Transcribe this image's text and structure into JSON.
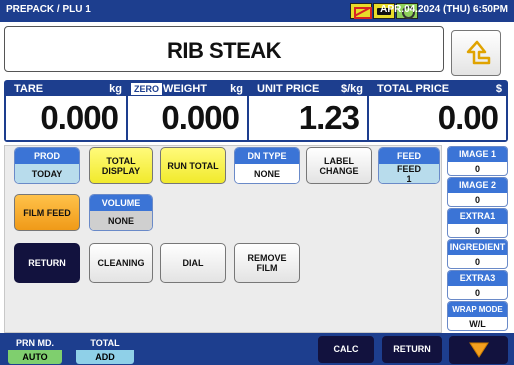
{
  "header": {
    "breadcrumb": "PREPACK / PLU 1",
    "datetime": "APR.04.2024 (THU)  6:50PM",
    "status_icons": [
      "no-label-icon",
      "battery-icon",
      "network-icon"
    ]
  },
  "product": {
    "name": "RIB STEAK"
  },
  "display": {
    "tare": {
      "label": "TARE",
      "unit": "kg",
      "value": "0.000"
    },
    "weight": {
      "badge": "ZERO",
      "label": "WEIGHT",
      "unit": "kg",
      "value": "0.000"
    },
    "unit_price": {
      "label": "UNIT PRICE",
      "unit": "$/kg",
      "value": "1.23"
    },
    "total_price": {
      "label": "TOTAL PRICE",
      "unit": "$",
      "value": "0.00"
    }
  },
  "buttons": {
    "prod": {
      "label": "PROD",
      "value": "TODAY"
    },
    "total_display": "TOTAL\nDISPLAY",
    "run_total": "RUN TOTAL",
    "dn_type": {
      "label": "DN TYPE",
      "value": "NONE"
    },
    "label_change": "LABEL\nCHANGE",
    "feed": {
      "label": "FEED",
      "value": "FEED\n1"
    },
    "film_feed": "FILM FEED",
    "volume": {
      "label": "VOLUME",
      "value": "NONE"
    },
    "return": "RETURN",
    "cleaning": "CLEANING",
    "dial": "DIAL",
    "remove_film": "REMOVE\nFILM"
  },
  "side_items": [
    {
      "label": "IMAGE 1",
      "value": "0"
    },
    {
      "label": "IMAGE 2",
      "value": "0"
    },
    {
      "label": "EXTRA1",
      "value": "0"
    },
    {
      "label": "INGREDIENT",
      "value": "0"
    },
    {
      "label": "EXTRA3",
      "value": "0"
    },
    {
      "label": "WRAP MODE",
      "value": "W/L"
    }
  ],
  "bottom": {
    "prn_md": {
      "label": "PRN MD.",
      "value": "AUTO"
    },
    "total": {
      "label": "TOTAL",
      "value": "ADD"
    },
    "calc": "CALC",
    "return": "RETURN"
  }
}
